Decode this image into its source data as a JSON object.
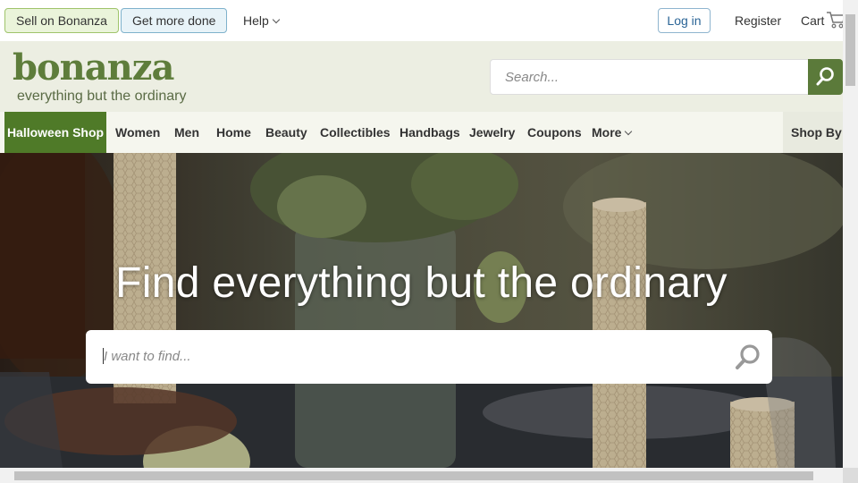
{
  "topbar": {
    "sell_label": "Sell on Bonanza",
    "getmore_label": "Get more done",
    "help_label": "Help",
    "login_label": "Log in",
    "register_label": "Register",
    "cart_label": "Cart"
  },
  "header": {
    "logo": "bonanza",
    "tagline": "everything but the ordinary",
    "search_placeholder": "Search..."
  },
  "nav": {
    "items": [
      "Halloween Shop",
      "Women",
      "Men",
      "Home",
      "Beauty",
      "Collectibles",
      "Handbags",
      "Jewelry",
      "Coupons",
      "More"
    ],
    "shop_by": "Shop By"
  },
  "hero": {
    "title": "Find everything but the ordinary",
    "search_placeholder": "I want to find..."
  },
  "colors": {
    "brand_green": "#5b7a3a",
    "nav_active": "#4f7a28",
    "header_bg": "#eceee2"
  },
  "icons": [
    "search-icon",
    "cart-icon",
    "chevron-down-icon"
  ]
}
